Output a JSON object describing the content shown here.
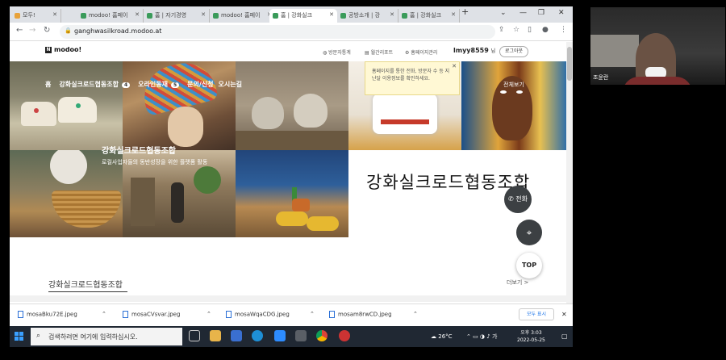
{
  "browser": {
    "tabs": [
      {
        "label": "모두!"
      },
      {
        "label": "modoo! 홈페이"
      },
      {
        "label": "홈 | 자기경영"
      },
      {
        "label": "modoo! 홈페이"
      },
      {
        "label": "홈 | 강화실크"
      },
      {
        "label": "공방소개 | 강"
      },
      {
        "label": "홈 | 강화실크"
      }
    ],
    "new_tab": "+",
    "url": "ganghwasilkroad.modoo.at"
  },
  "site": {
    "logo": "modoo!",
    "top_links": [
      "방문자통계",
      "월간리포트",
      "홈페이지관리"
    ],
    "user": "lmyy8559",
    "user_suffix": "님",
    "logout": "로그아웃",
    "nav": {
      "home": "홈",
      "about": "강화실크로드협동조합",
      "about_count": "4",
      "products": "오라인동재",
      "products_count": "5",
      "inquiry": "문의/신청",
      "directions": "오시는길",
      "all_menu": "전체보기"
    },
    "tooltip": "홈페이지를 통한 전화, 방문자 수 등 지난달 이용정보를 확인하세요.",
    "hero_title": "강화실크로드협동조합",
    "hero_desc": "로컬사업자들의 동반성장을 위한 플랫폼 활동",
    "brush_text": "강화실크로드협동조합",
    "section_title": "강화실크로드협동조합",
    "more": "더보기 >",
    "call_button": "전화",
    "top_button": "TOP"
  },
  "downloads": {
    "files": [
      "mosaBku72E.jpeg",
      "mosaCVsvar.jpeg",
      "mosaWqaCDG.jpeg",
      "mosam8rwCD.jpeg"
    ],
    "show_all": "모두 표시"
  },
  "taskbar": {
    "search_placeholder": "검색하려면 여기에 입력하십시오.",
    "weather": "26°C",
    "time": "오후 3:03",
    "date": "2022-05-25"
  },
  "webcam": {
    "participant_name": "조윤란"
  }
}
